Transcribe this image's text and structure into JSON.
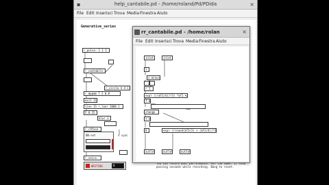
{
  "back_window": {
    "title": "help_cantabile.pd  - /home/roland/Pd/PDida",
    "menu": [
      "File",
      "Edit",
      "Inserisci",
      "Trova",
      "Media",
      "Finestra",
      "Aiuto"
    ],
    "heading": "Generative_series",
    "objects": [
      "r_pulse: 1 1 1",
      "r_cantabile",
      "r_circle 4 4 1",
      "r_mppmm 7 2 0.8",
      "exit 11",
      "line 15 r_loor 2000 1",
      "5 0.15",
      "blur 1",
      "r_rdfase",
      "r_voice"
    ],
    "number_values": [
      "16",
      "12",
      "9",
      "0.15"
    ],
    "gui_label": "ON-set",
    "status_label": "WRITING",
    "status_value": "0",
    "side_label": "s sync",
    "footer_comment": "You can record your performance. Put the name. It show passing seconds while recording. Bang to reset."
  },
  "front_window": {
    "title": "rr_cantabile.pd - /home/rolan",
    "menu": [
      "File",
      "Edit",
      "Inserisci",
      "Trova",
      "Media",
      "Finestra",
      "Aiuto"
    ],
    "objects": {
      "inlet_left": "inlet",
      "inlet_right": "inlet",
      "t_b": "t b",
      "s_minus": "s minus",
      "r_block": "r 1",
      "expr1": "expr ((($f1/4))*3) *$f1 %2",
      "f_b": "f 0",
      "change": "change -1",
      "t_fb": "t b",
      "zero": "0",
      "expr2": "expr ((round($f2/2) + ($f2/4))*3) %7",
      "outlet1": "outlet",
      "outlet2": "outlet",
      "outlet3": "outlet"
    }
  },
  "colors": {
    "status_red": "#cc2222",
    "slider_fill": "#222222",
    "window_bg": "#efefef",
    "canvas_bg": "#ffffff"
  }
}
